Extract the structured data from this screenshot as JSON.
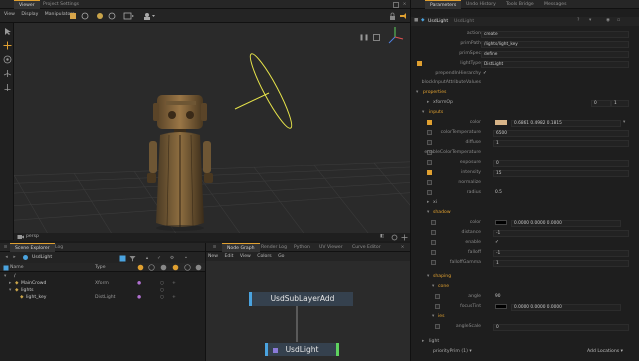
{
  "viewer": {
    "tabs": [
      "Viewer",
      "Project Settings"
    ],
    "menu": [
      "View",
      "Display",
      "Manipulators"
    ],
    "camera_label": "persp"
  },
  "scene_explorer": {
    "tabs": [
      "Scene Explorer",
      "Log"
    ],
    "path": "UsdLight",
    "columns": [
      "Name",
      "Type"
    ],
    "rows": [
      {
        "name": "/",
        "type": ""
      },
      {
        "name": "MainCrowd",
        "type": "Xform"
      },
      {
        "name": "lights",
        "type": ""
      },
      {
        "name": "light_key",
        "type": "DistLight"
      }
    ]
  },
  "node_graph": {
    "tabs": [
      "Node Graph",
      "Render Log",
      "Python",
      "UV Viewer",
      "Curve Editor"
    ],
    "menu": [
      "New",
      "Edit",
      "View",
      "Colors",
      "Go"
    ],
    "nodes": [
      "UsdSubLayerAdd",
      "UsdLight"
    ]
  },
  "params": {
    "tabs": [
      "Parameters",
      "Undo History",
      "Tools Bridge",
      "Messages"
    ],
    "node_name": "UsdLight",
    "node_type": "UsdLight",
    "fields": [
      {
        "label": "action",
        "value": "create"
      },
      {
        "label": "primPath",
        "value": "/lights/light_key"
      },
      {
        "label": "primSpec",
        "value": "define"
      },
      {
        "label": "lightType",
        "value": "DistLight"
      },
      {
        "label": "prependInHierarchy",
        "value": "✓"
      },
      {
        "label": "blockInputAttributeValues",
        "value": ""
      }
    ],
    "sections": {
      "properties": "properties",
      "xformop": "xformOp",
      "xform_val": "0",
      "xform_val2": "1",
      "inputs": "inputs",
      "xi": "xi",
      "shadow": "shadow",
      "shaping": "shaping",
      "cone": "cone",
      "ies": "ies",
      "light": "light",
      "add_locations": "Add Locations ▾",
      "priority_label": "priorityPrim (1) ▾"
    },
    "inputs": [
      {
        "label": "color",
        "value": "0.6861   0.4982   0.1815"
      },
      {
        "label": "colorTemperature",
        "value": "6500"
      },
      {
        "label": "diffuse",
        "value": "1"
      },
      {
        "label": "enableColorTemperature",
        "value": ""
      },
      {
        "label": "exposure",
        "value": "0"
      },
      {
        "label": "intensity",
        "value": "15"
      },
      {
        "label": "normalize",
        "value": ""
      },
      {
        "label": "radius",
        "value": "0.5"
      }
    ],
    "shadow": [
      {
        "label": "color",
        "value": "0.0000   0.0000   0.0000"
      },
      {
        "label": "distance",
        "value": "-1"
      },
      {
        "label": "enable",
        "value": "✓"
      },
      {
        "label": "falloff",
        "value": "-1"
      },
      {
        "label": "falloffGamma",
        "value": "1"
      }
    ],
    "cone": [
      {
        "label": "angle",
        "value": "90"
      },
      {
        "label": "focusTint",
        "value": "0.0000   0.0000   0.0000"
      }
    ],
    "ies": [
      {
        "label": "angleScale",
        "value": "0"
      }
    ]
  },
  "colors": {
    "accent": "#e0a030",
    "light_gizmo": "#e6e34a",
    "swatch": "#d8b488",
    "node_blue": "#4aa3df"
  }
}
